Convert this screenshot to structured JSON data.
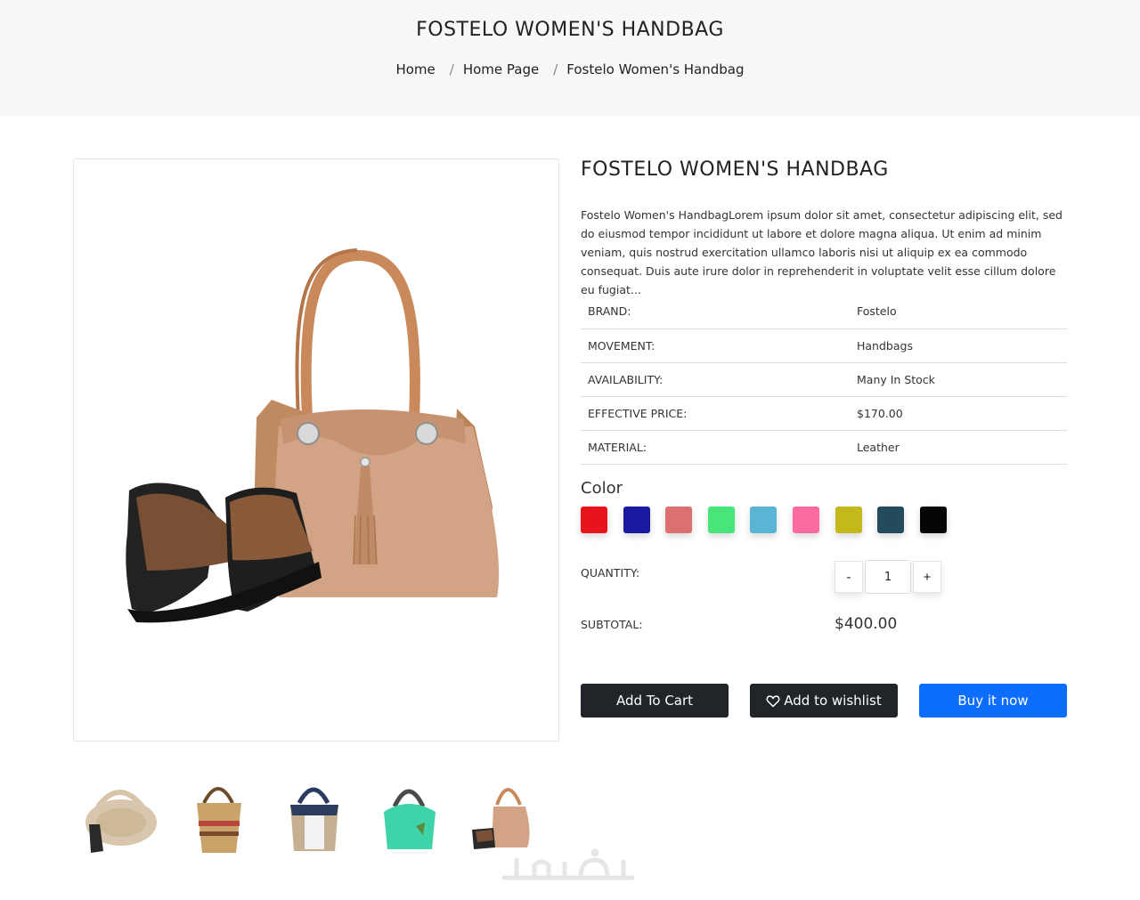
{
  "header": {
    "title": "FOSTELO WOMEN'S HANDBAG",
    "breadcrumb": [
      "Home",
      "Home Page",
      "Fostelo Women's Handbag"
    ],
    "breadcrumb_separator": "/"
  },
  "product": {
    "title": "FOSTELO WOMEN'S HANDBAG",
    "description": "Fostelo Women's HandbagLorem ipsum dolor sit amet, consectetur adipiscing elit, sed do eiusmod tempor incididunt ut labore et dolore magna aliqua. Ut enim ad minim veniam, quis nostrud exercitation ullamco laboris nisi ut aliquip ex ea commodo consequat. Duis aute irure dolor in reprehenderit in voluptate velit esse cillum dolore eu fugiat...",
    "specs": [
      {
        "label": "BRAND:",
        "value": "Fostelo"
      },
      {
        "label": "MOVEMENT:",
        "value": "Handbags"
      },
      {
        "label": "AVAILABILITY:",
        "value": "Many In Stock"
      },
      {
        "label": "EFFECTIVE PRICE:",
        "value": "$170.00"
      },
      {
        "label": "MATERIAL:",
        "value": "Leather"
      }
    ],
    "color_label": "Color",
    "colors": [
      "#e8141b",
      "#1a1aa0",
      "#dc7070",
      "#48e57a",
      "#5ab4d4",
      "#fc6aa2",
      "#c5b81a",
      "#244b5c",
      "#050505"
    ],
    "quantity_label": "QUANTITY:",
    "quantity": {
      "minus": "-",
      "value": "1",
      "plus": "+"
    },
    "subtotal_label": "SUBTOTAL:",
    "subtotal_value": "$400.00"
  },
  "actions": {
    "add_to_cart": "Add To Cart",
    "add_to_wishlist": "Add to wishlist",
    "buy_now": "Buy it now"
  },
  "thumbnails": [
    "round-cream-bag",
    "striped-straw-tote",
    "navy-white-tote",
    "mint-green-bag",
    "tan-bag-with-shoes"
  ]
}
